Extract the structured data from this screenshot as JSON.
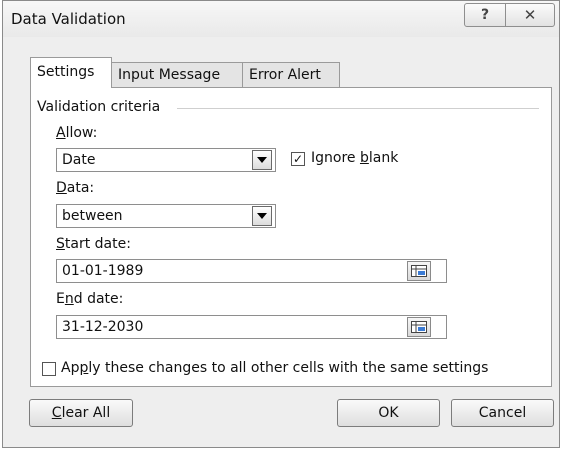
{
  "window": {
    "title": "Data Validation",
    "help_glyph": "?",
    "close_glyph": "✕"
  },
  "tabs": [
    {
      "label": "Settings",
      "active": true
    },
    {
      "label": "Input Message",
      "active": false
    },
    {
      "label": "Error Alert",
      "active": false
    }
  ],
  "settings": {
    "group_label": "Validation criteria",
    "allow": {
      "label_accel": "A",
      "label_rest": "llow:",
      "value": "Date"
    },
    "ignore_blank": {
      "label_pre": "Ignore ",
      "label_accel": "b",
      "label_rest": "lank",
      "checked": true,
      "check_glyph": "✓"
    },
    "data": {
      "label_accel": "D",
      "label_rest": "ata:",
      "value": "between"
    },
    "start_date": {
      "label_accel": "S",
      "label_rest": "tart date:",
      "value": "01-01-1989"
    },
    "end_date": {
      "label_pre": "E",
      "label_accel": "n",
      "label_rest": "d date:",
      "value": "31-12-2030"
    },
    "apply_all": {
      "label_pre": "Ap",
      "label_accel": "p",
      "label_rest": "ly these changes to all other cells with the same settings",
      "checked": false
    }
  },
  "buttons": {
    "clear_all": {
      "label_accel": "C",
      "label_rest": "lear All"
    },
    "ok": "OK",
    "cancel": "Cancel"
  }
}
